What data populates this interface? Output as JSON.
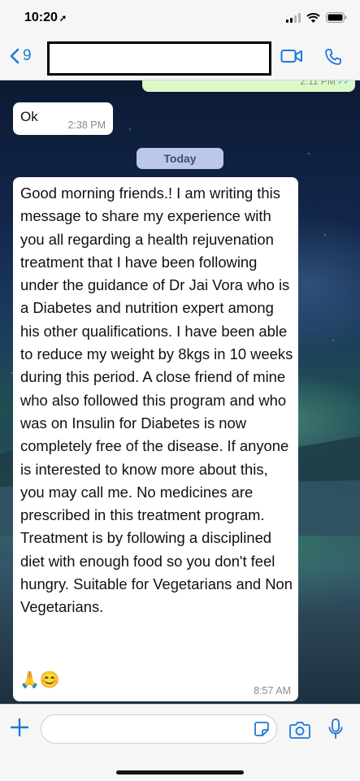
{
  "status_bar": {
    "time": "10:20"
  },
  "nav": {
    "back_count": "9"
  },
  "chat": {
    "outgoing_partial": {
      "time": "2:11 PM"
    },
    "ok_message": {
      "text": "Ok",
      "time": "2:38 PM"
    },
    "date_separator": "Today",
    "long_message": {
      "text": "Good morning friends.! I am writing this message to share my experience with you all regarding a health rejuvenation treatment that I have been following under the guidance of Dr Jai Vora who is a Diabetes and nutrition expert among his other qualifications. I have been able to reduce my weight by 8kgs in 10 weeks during this period. A close friend of mine who also followed this program and who was on Insulin for Diabetes is now completely free of the disease. If anyone is interested to know more about this, you may call me. No medicines are prescribed in this treatment program. Treatment is by following a disciplined diet with enough food so you don't feel hungry. Suitable for Vegetarians and Non Vegetarians.",
      "emoji": "🙏😊",
      "time": "8:57 AM"
    }
  },
  "colors": {
    "accent": "#1b7ad8",
    "outgoing_bubble": "#dcf8c6",
    "date_chip": "#bcc8e8"
  },
  "icons": {
    "status": [
      "location-arrow-icon",
      "signal-icon",
      "wifi-icon",
      "battery-icon"
    ],
    "nav": [
      "back-chevron-icon",
      "video-call-icon",
      "phone-icon"
    ],
    "input": [
      "plus-icon",
      "sticker-icon",
      "camera-icon",
      "microphone-icon"
    ]
  }
}
